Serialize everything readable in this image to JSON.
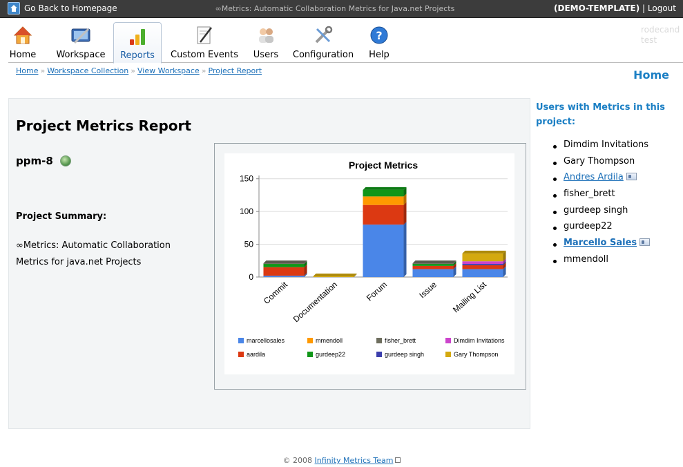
{
  "topbar": {
    "back_label": "Go Back to Homepage",
    "app_title": "∞Metrics: Automatic Collaboration Metrics for Java.net Projects",
    "template_label": "(DEMO-TEMPLATE)",
    "separator": " | ",
    "logout_label": "Logout"
  },
  "nav": {
    "items": [
      {
        "label": "Home",
        "icon": "home-icon"
      },
      {
        "label": "Workspace",
        "icon": "workspace-icon"
      },
      {
        "label": "Reports",
        "icon": "reports-icon",
        "active": true
      },
      {
        "label": "Custom Events",
        "icon": "custom-events-icon"
      },
      {
        "label": "Users",
        "icon": "users-icon"
      },
      {
        "label": "Configuration",
        "icon": "configuration-icon"
      },
      {
        "label": "Help",
        "icon": "help-icon"
      }
    ],
    "user_line1": "rodecand",
    "user_line2": "test"
  },
  "breadcrumb": [
    "Home",
    "Workspace Collection",
    "View Workspace",
    "Project Report"
  ],
  "home_heading": "Home",
  "report": {
    "title": "Project Metrics Report",
    "project_name": "ppm-8",
    "summary_label": "Project Summary:",
    "summary_text": "∞Metrics: Automatic Collaboration Metrics for java.net Projects"
  },
  "chart_data": {
    "type": "bar",
    "stacked": true,
    "title": "Project Metrics",
    "categories": [
      "Commit",
      "Documentation",
      "Forum",
      "Issue",
      "Mailing List"
    ],
    "ylim": [
      0,
      155
    ],
    "yticks": [
      0,
      50,
      100,
      150
    ],
    "grid": true,
    "legend_position": "bottom",
    "series": [
      {
        "name": "marcellosales",
        "color": "#4a86e8",
        "values": [
          2,
          0,
          80,
          12,
          12
        ]
      },
      {
        "name": "aardila",
        "color": "#dc3912",
        "values": [
          13,
          0,
          30,
          5,
          6
        ]
      },
      {
        "name": "mmendoll",
        "color": "#ff9900",
        "values": [
          0,
          0,
          13,
          0,
          0
        ]
      },
      {
        "name": "gurdeep22",
        "color": "#109618",
        "values": [
          5,
          0,
          10,
          3,
          0
        ]
      },
      {
        "name": "fisher_brett",
        "color": "#6e6e5e",
        "values": [
          1,
          0,
          0,
          1,
          0
        ]
      },
      {
        "name": "gurdeep singh",
        "color": "#3b3eac",
        "values": [
          0,
          0,
          0,
          0,
          2
        ]
      },
      {
        "name": "Dimdim Invitations",
        "color": "#cc44cc",
        "values": [
          0,
          0,
          0,
          0,
          4
        ]
      },
      {
        "name": "Gary Thompson",
        "color": "#d4a90f",
        "values": [
          0,
          1,
          0,
          0,
          12
        ]
      }
    ]
  },
  "users": {
    "heading": "Users with Metrics in this project:",
    "list": [
      {
        "name": "Dimdim Invitations",
        "link": false,
        "card": false,
        "bold": false
      },
      {
        "name": "Gary Thompson",
        "link": false,
        "card": false,
        "bold": false
      },
      {
        "name": "Andres Ardila",
        "link": true,
        "card": true,
        "bold": false
      },
      {
        "name": "fisher_brett",
        "link": false,
        "card": false,
        "bold": false
      },
      {
        "name": "gurdeep singh",
        "link": false,
        "card": false,
        "bold": false
      },
      {
        "name": "gurdeep22",
        "link": false,
        "card": false,
        "bold": false
      },
      {
        "name": "Marcello Sales",
        "link": true,
        "card": true,
        "bold": true
      },
      {
        "name": "mmendoll",
        "link": false,
        "card": false,
        "bold": false
      }
    ]
  },
  "footer": {
    "copyright": "© 2008 ",
    "team_link": "Infinity Metrics Team"
  }
}
